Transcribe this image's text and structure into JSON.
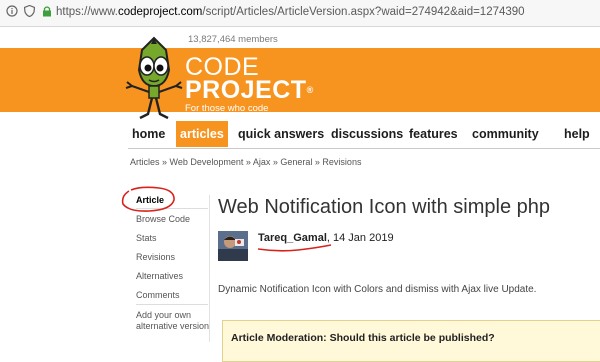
{
  "browser": {
    "url_prefix": "https://www.",
    "url_domain": "codeproject.com",
    "url_path": "/script/Articles/ArticleVersion.aspx?waid=274942&aid=1274390"
  },
  "header": {
    "members": "13,827,464 members",
    "brand_line1": "CODE",
    "brand_line2": "PROJECT",
    "brand_reg": "®",
    "tagline": "For those who code"
  },
  "nav": {
    "items": [
      {
        "label": "home"
      },
      {
        "label": "articles"
      },
      {
        "label": "quick answers"
      },
      {
        "label": "discussions"
      },
      {
        "label": "features"
      },
      {
        "label": "community"
      },
      {
        "label": "help"
      }
    ],
    "active": "articles"
  },
  "breadcrumb": "Articles » Web Development » Ajax » General » Revisions",
  "sidebar": {
    "items": [
      {
        "label": "Article"
      },
      {
        "label": "Browse Code"
      },
      {
        "label": "Stats"
      },
      {
        "label": "Revisions"
      },
      {
        "label": "Alternatives"
      },
      {
        "label": "Comments"
      }
    ],
    "add_line1": "Add your own",
    "add_line2": "alternative version"
  },
  "article": {
    "title": "Web Notification Icon with simple php",
    "author": "Tareq_Gamal",
    "date": ", 14 Jan 2019",
    "summary": "Dynamic Notification Icon with Colors and dismiss with Ajax live Update.",
    "moderation": "Article Moderation: Should this article be published?"
  },
  "colors": {
    "brand_orange": "#f79420",
    "annotation_red": "#d9221c"
  }
}
